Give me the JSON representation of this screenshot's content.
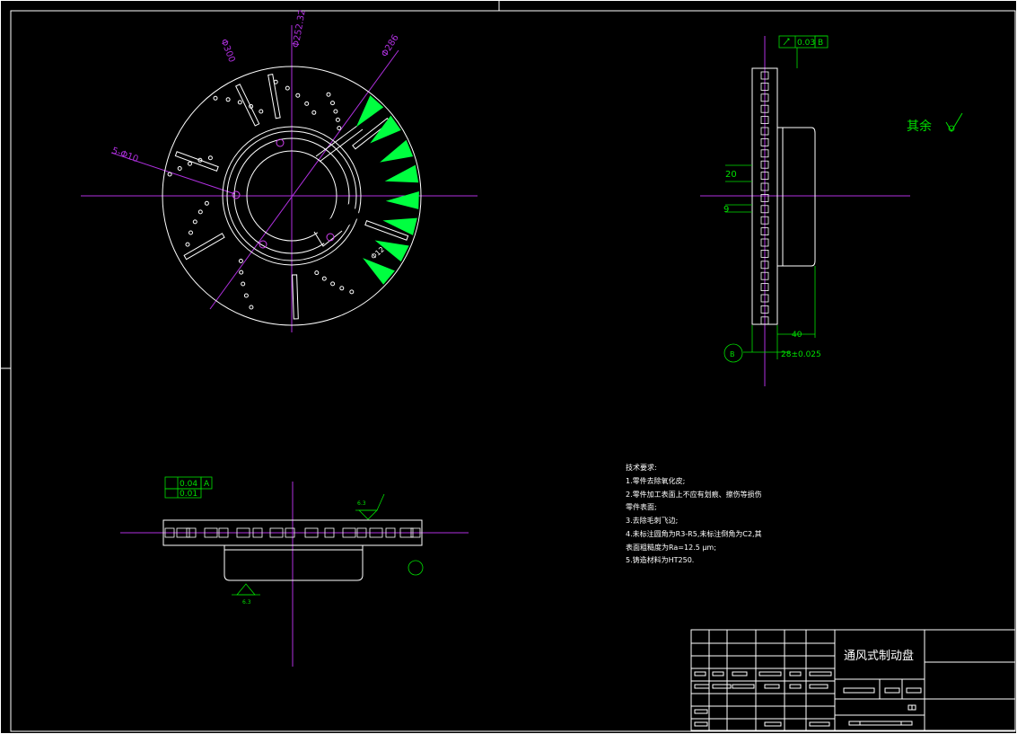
{
  "title_block": {
    "part_name": "通风式制动盘"
  },
  "top_view": {
    "dim_d300": "Φ300",
    "dim_d252": "Φ252.32",
    "dim_d286": "Φ286",
    "dim_holes": "5-Φ10",
    "dim_d12": "Φ12"
  },
  "side_view": {
    "runout_value": "0.03",
    "runout_datum": "B",
    "dim_20": "20",
    "dim_9": "9",
    "dim_40": "40",
    "dim_28": "28±0.025",
    "datum_b": "B",
    "surface_note": "其余"
  },
  "front_section": {
    "flatness_value": "0.04",
    "flatness_datum": "A",
    "parallel_value": "0.01",
    "roughness_top": "6.3",
    "roughness_bottom": "6.3"
  },
  "tech_requirements": {
    "heading": "技术要求:",
    "line1": "1.零件去除氧化皮;",
    "line2": "2.零件加工表面上不应有划痕、擦伤等损伤",
    "line3": "零件表面;",
    "line4": "3.去除毛刺飞边;",
    "line5": "4.未标注圆角为R3-R5,未标注倒角为C2,其",
    "line6": "表面粗糙度为Ra=12.5          μm;",
    "line7": "5.铸造材料为HT250."
  },
  "colors": {
    "outline": "#ffffff",
    "centerline": "#b030e0",
    "dimension": "#00e000",
    "hatch": "#00ff40",
    "background": "#000000"
  }
}
